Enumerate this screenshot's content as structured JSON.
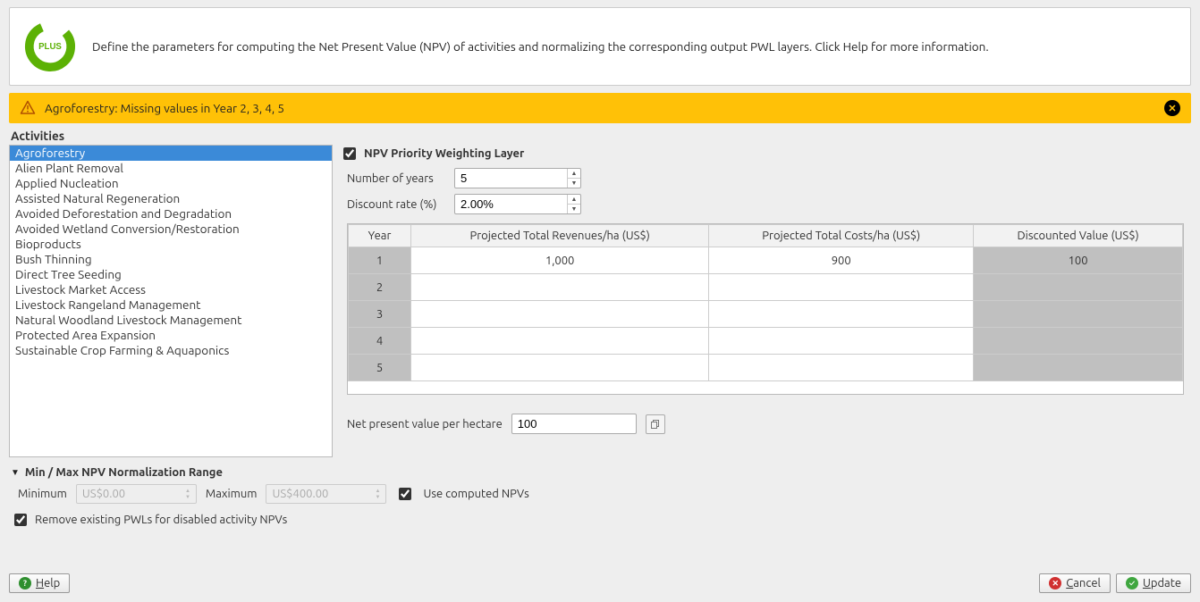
{
  "info": {
    "text": "Define the parameters for computing the Net Present Value (NPV) of activities and normalizing the corresponding output PWL layers. Click Help for more information."
  },
  "warning": {
    "text": "Agroforestry: Missing values in Year 2, 3, 4, 5"
  },
  "activities": {
    "heading": "Activities",
    "items": [
      "Agroforestry",
      "Alien Plant Removal",
      "Applied Nucleation",
      "Assisted Natural Regeneration",
      "Avoided Deforestation and Degradation",
      "Avoided Wetland Conversion/Restoration",
      "Bioproducts",
      "Bush Thinning",
      "Direct Tree Seeding",
      "Livestock Market Access",
      "Livestock Rangeland Management",
      "Natural Woodland Livestock Management",
      "Protected Area Expansion",
      "Sustainable Crop Farming & Aquaponics"
    ],
    "selected_index": 0
  },
  "npv": {
    "check_label": "NPV Priority Weighting Layer",
    "checked": true,
    "num_years_label": "Number of years",
    "num_years_value": "5",
    "discount_label": "Discount rate (%)",
    "discount_value": "2.00%",
    "table": {
      "col_year": "Year",
      "col_rev": "Projected Total Revenues/ha (US$)",
      "col_cost": "Projected Total Costs/ha (US$)",
      "col_disc": "Discounted Value (US$)",
      "rows": [
        {
          "year": "1",
          "rev": "1,000",
          "cost": "900",
          "disc": "100"
        },
        {
          "year": "2",
          "rev": "",
          "cost": "",
          "disc": ""
        },
        {
          "year": "3",
          "rev": "",
          "cost": "",
          "disc": ""
        },
        {
          "year": "4",
          "rev": "",
          "cost": "",
          "disc": ""
        },
        {
          "year": "5",
          "rev": "",
          "cost": "",
          "disc": ""
        }
      ]
    },
    "result_label": "Net present value per hectare",
    "result_value": "100"
  },
  "norm": {
    "heading": "Min / Max NPV Normalization Range",
    "min_label": "Minimum",
    "min_value": "US$0.00",
    "max_label": "Maximum",
    "max_value": "US$400.00",
    "use_computed_label": "Use computed NPVs",
    "use_computed_checked": true
  },
  "remove": {
    "label": "Remove existing PWLs for disabled activity NPVs",
    "checked": true
  },
  "buttons": {
    "help": "Help",
    "cancel": "Cancel",
    "update": "Update"
  }
}
